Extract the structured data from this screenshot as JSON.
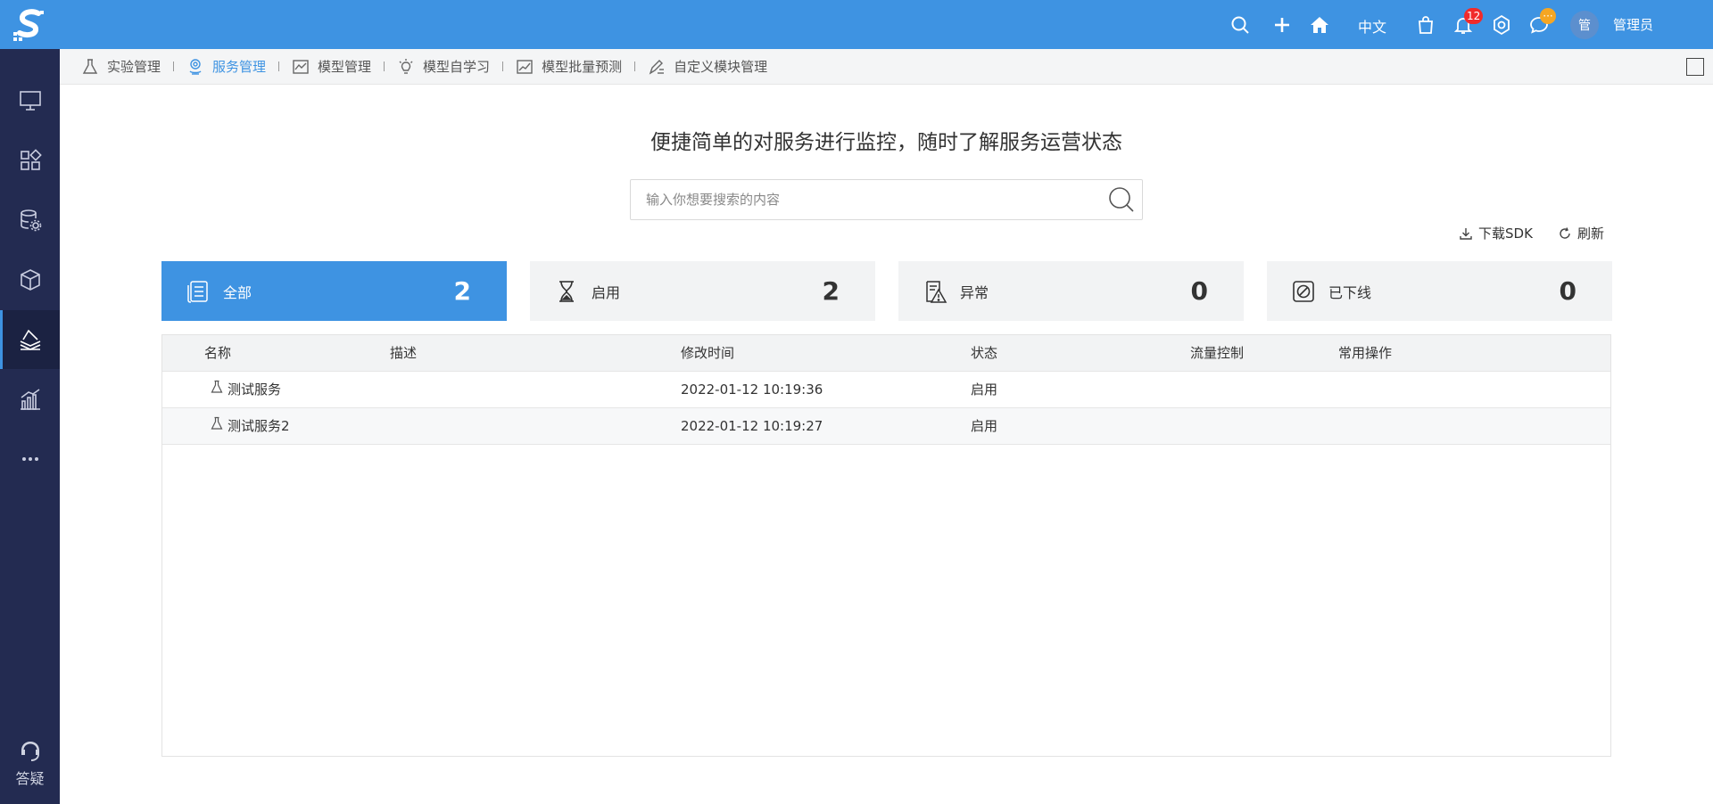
{
  "sidebar": {
    "items": [
      {
        "icon": "monitor-icon",
        "active": false
      },
      {
        "icon": "apps-grid-icon",
        "active": false
      },
      {
        "icon": "database-gear-icon",
        "active": false
      },
      {
        "icon": "cubes-icon",
        "active": false
      },
      {
        "icon": "service-layers-icon",
        "active": true
      },
      {
        "icon": "bar-chart-icon",
        "active": false
      },
      {
        "icon": "more-dots-icon",
        "active": false
      }
    ],
    "help_label": "答疑"
  },
  "topbar": {
    "language": "中文",
    "notification_count": "12",
    "message_badge": "···",
    "avatar_text": "管",
    "username": "管理员"
  },
  "subnav": {
    "items": [
      {
        "label": "实验管理",
        "icon": "flask-icon",
        "active": false
      },
      {
        "label": "服务管理",
        "icon": "service-icon",
        "active": true
      },
      {
        "label": "模型管理",
        "icon": "model-chart-icon",
        "active": false
      },
      {
        "label": "模型自学习",
        "icon": "lightbulb-icon",
        "active": false
      },
      {
        "label": "模型批量预测",
        "icon": "trend-chart-icon",
        "active": false
      },
      {
        "label": "自定义模块管理",
        "icon": "edit-list-icon",
        "active": false
      }
    ]
  },
  "main": {
    "headline": "便捷简单的对服务进行监控，随时了解服务运营状态",
    "search_placeholder": "输入你想要搜索的内容",
    "download_sdk": "下载SDK",
    "refresh": "刷新",
    "cards": [
      {
        "label": "全部",
        "count": "2",
        "icon": "all-list-icon",
        "active": true
      },
      {
        "label": "启用",
        "count": "2",
        "icon": "hourglass-icon",
        "active": false
      },
      {
        "label": "异常",
        "count": "0",
        "icon": "warning-doc-icon",
        "active": false
      },
      {
        "label": "已下线",
        "count": "0",
        "icon": "offline-icon",
        "active": false
      }
    ],
    "table": {
      "columns": [
        "名称",
        "描述",
        "修改时间",
        "状态",
        "流量控制",
        "常用操作"
      ],
      "rows": [
        {
          "name": "测试服务",
          "description": "",
          "modified": "2022-01-12 10:19:36",
          "status": "启用",
          "flow": "",
          "ops": ""
        },
        {
          "name": "测试服务2",
          "description": "",
          "modified": "2022-01-12 10:19:27",
          "status": "启用",
          "flow": "",
          "ops": ""
        }
      ]
    }
  },
  "colors": {
    "primary": "#3e93e2",
    "sidebar": "#232b51",
    "badge": "#f12b2b"
  }
}
